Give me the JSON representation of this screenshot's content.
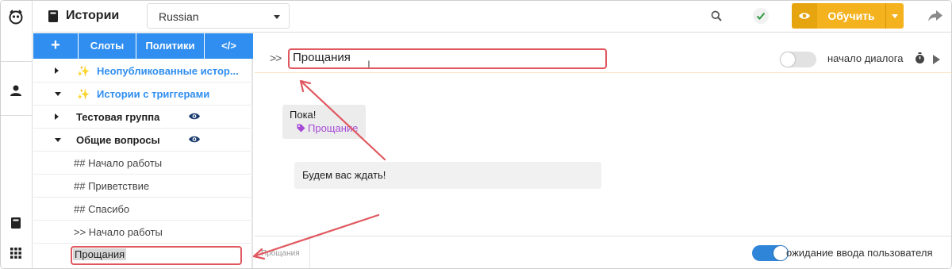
{
  "header": {
    "title": "Истории",
    "language": {
      "selected": "Russian"
    },
    "train_button": "Обучить"
  },
  "sidebar": {
    "toolbar": {
      "add": "+",
      "slots": "Слоты",
      "policies": "Политики",
      "code": "</>"
    },
    "tree": [
      {
        "label": "Неопубликованные истор...",
        "state": "collapsed",
        "icon": "sparkle-icon"
      },
      {
        "label": "Истории с триггерами",
        "state": "expanded",
        "icon": "sparkle-icon"
      },
      {
        "label": "Тестовая группа",
        "state": "collapsed",
        "icon": "eye-icon"
      },
      {
        "label": "Общие вопросы",
        "state": "expanded",
        "icon": "eye-icon"
      },
      {
        "label": "## Начало работы"
      },
      {
        "label": "## Приветствие"
      },
      {
        "label": "## Спасибо"
      },
      {
        "label": ">> Начало работы"
      },
      {
        "label": "Прощания",
        "selected": true
      }
    ]
  },
  "story": {
    "chevron": ">>",
    "title": "Прощания",
    "start_toggle_label": "начало диалога",
    "start_toggle_on": false,
    "messages": {
      "user_text": "Пока!",
      "user_intent": "Прощание",
      "bot_text": "Будем вас ждать!"
    },
    "footer": {
      "tab": "Прощания",
      "wait_label": "ожидание ввода пользователя",
      "wait_toggle_on": true
    }
  },
  "colors": {
    "accent": "#2f8ef0",
    "train": "#f3b21e",
    "intent": "#a64ad6",
    "annotation": "#e0585f"
  }
}
